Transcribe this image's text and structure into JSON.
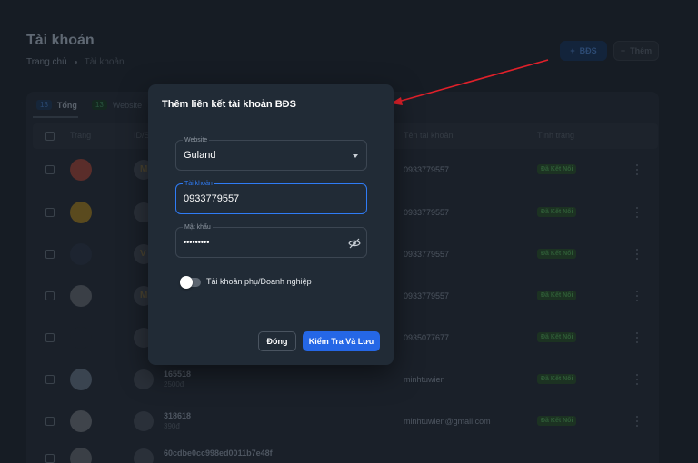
{
  "page": {
    "title": "Tài khoản",
    "breadcrumb": [
      "Trang chủ",
      "Tài khoản"
    ],
    "buttons": {
      "bds": "BĐS",
      "add": "Thêm"
    }
  },
  "tabs": [
    {
      "count": "13",
      "label": "Tổng"
    },
    {
      "count": "13",
      "label": "Website"
    }
  ],
  "table": {
    "headers": [
      "Trang",
      "ID/SĐT",
      "Tên tài khoản",
      "Tình trạng"
    ],
    "rows": [
      {
        "id": "",
        "sub": "",
        "account": "0933779557",
        "status": "Đã Kết Nối",
        "logo_color": "#5a2d2a",
        "avatar": "M"
      },
      {
        "id": "",
        "sub": "",
        "account": "0933779557",
        "status": "Đã Kết Nối",
        "logo_color": "#5a4a1e",
        "avatar": ""
      },
      {
        "id": "",
        "sub": "",
        "account": "0933779557",
        "status": "Đã Kết Nối",
        "logo_color": "#1d2430",
        "avatar": "V"
      },
      {
        "id": "",
        "sub": "",
        "account": "0933779557",
        "status": "Đã Kết Nối",
        "logo_color": "#3a3f46",
        "avatar": "M"
      },
      {
        "id": "",
        "sub": "",
        "account": "0935077677",
        "status": "Đã Kết Nối",
        "logo_color": "#1a2029",
        "avatar": ""
      },
      {
        "id": "165518",
        "sub": "2500đ",
        "account": "minhtuwien",
        "status": "Đã Kết Nối",
        "logo_color": "#3a4450",
        "avatar": ""
      },
      {
        "id": "318618",
        "sub": "390đ",
        "account": "minhtuwien@gmail.com",
        "status": "Đã Kết Nối",
        "logo_color": "#3f444b",
        "avatar": ""
      },
      {
        "id": "60cdbe0cc998ed0011b7e48f",
        "sub": "",
        "account": "",
        "status": "",
        "logo_color": "#3a3f46",
        "avatar": ""
      }
    ]
  },
  "modal": {
    "title": "Thêm liên kết tài khoản BĐS",
    "website": {
      "label": "Website",
      "value": "Guland"
    },
    "account": {
      "label": "Tài khoản",
      "value": "0933779557"
    },
    "password": {
      "label": "Mật khẩu",
      "value": "•••••••••"
    },
    "toggle_label": "Tài khoản phụ/Doanh nghiệp",
    "close_label": "Đóng",
    "save_label": "Kiểm Tra Và Lưu"
  },
  "colors": {
    "primary": "#2567e6",
    "focus": "#2f7cf6",
    "annotation_arrow": "#e0202a"
  }
}
